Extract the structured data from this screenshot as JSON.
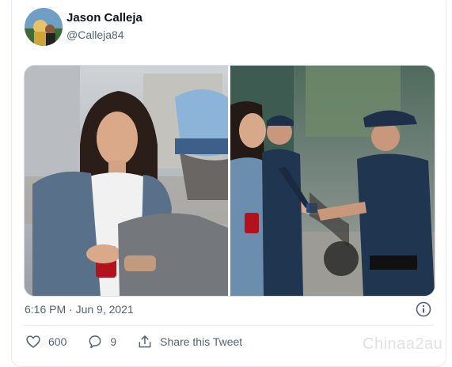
{
  "author": {
    "display_name": "Jason Calleja",
    "handle": "@Calleja84",
    "avatar_icon": "user-avatar"
  },
  "media": {
    "left_photo": "woman-handing-can-photo",
    "right_photo": "woman-handing-can-to-police-photo"
  },
  "meta": {
    "timestamp": "6:16 PM · Jun 9, 2021",
    "info_icon": "info-icon"
  },
  "actions": {
    "like_icon": "heart-icon",
    "like_count": "600",
    "reply_icon": "comment-icon",
    "reply_count": "9",
    "share_icon": "share-icon",
    "share_label": "Share this Tweet"
  },
  "watermark": {
    "text": "Chinaa2au"
  },
  "colors": {
    "secondary_text": "#536471",
    "border": "#e6ecf0",
    "primary_text": "#0f1419"
  }
}
